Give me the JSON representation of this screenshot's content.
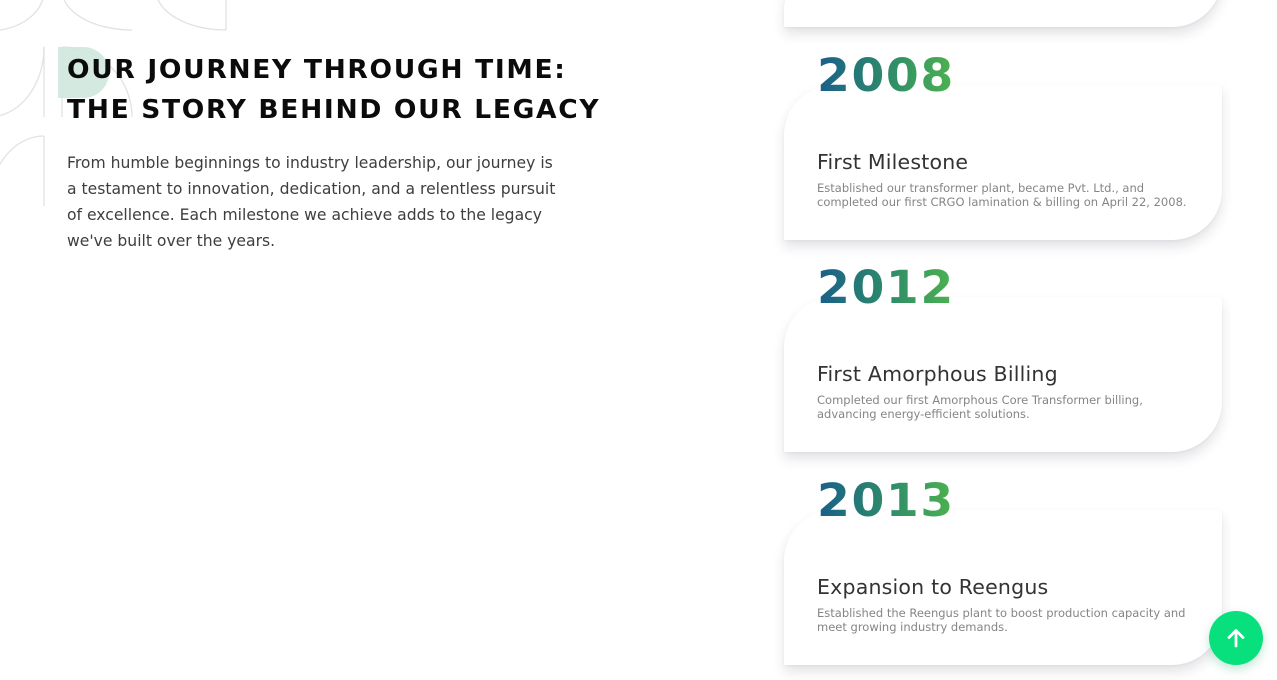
{
  "intro": {
    "heading_line1": "Our Journey Through Time:",
    "heading_line2": "The Story Behind Our Legacy",
    "text": "From humble beginnings to industry leadership, our journey is a testament to innovation, dedication, and a relentless pursuit of excellence. Each milestone we achieve adds to the legacy we've built over the years."
  },
  "timeline": [
    {
      "year": "2008",
      "title": "First Milestone",
      "description": "Established our transformer plant, became Pvt. Ltd., and completed our first CRGO lamination & billing on April 22, 2008."
    },
    {
      "year": "2012",
      "title": "First Amorphous Billing",
      "description": "Completed our first Amorphous Core Transformer billing, advancing energy-efficient solutions."
    },
    {
      "year": "2013",
      "title": "Expansion to Reengus",
      "description": "Established the Reengus plant to boost production capacity and meet growing industry demands."
    }
  ],
  "scroll_top": {
    "icon": "arrow-up-icon"
  },
  "colors": {
    "year_gradient_start": "#1a5e8a",
    "year_gradient_end": "#4db24f",
    "scroll_top_button": "#08e07e",
    "heading": "#0b0b0b",
    "body_text": "#3e3e3e"
  }
}
